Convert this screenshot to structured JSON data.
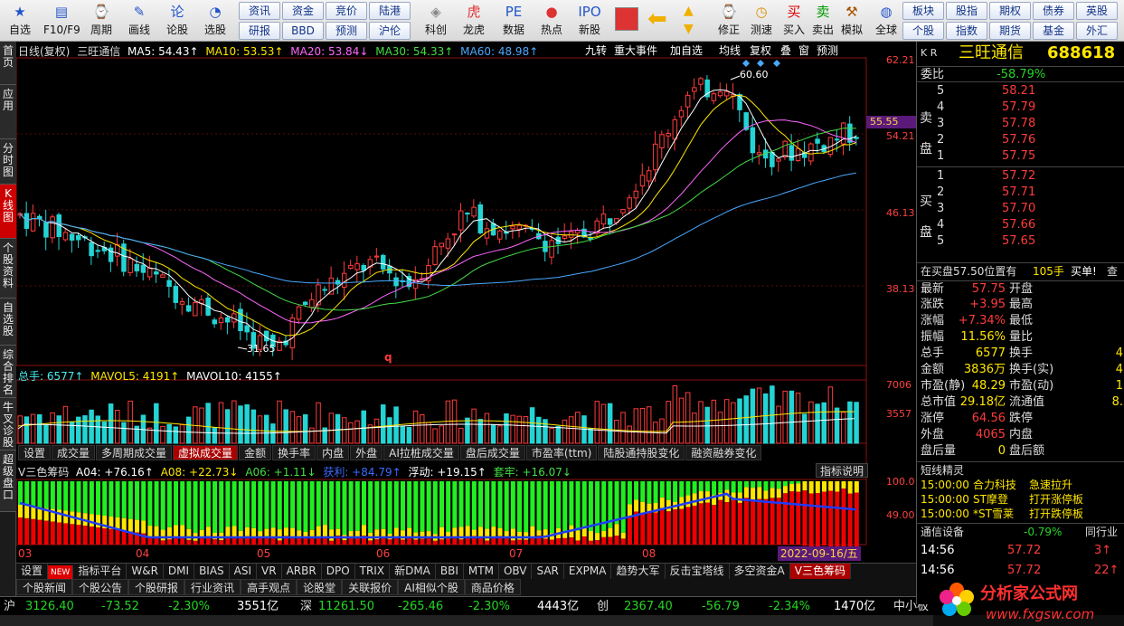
{
  "toolbar": {
    "buttons": [
      {
        "label": "自选",
        "icon": "★"
      },
      {
        "label": "F10/F9",
        "icon": "▤"
      },
      {
        "label": "周期",
        "icon": "⌚"
      },
      {
        "label": "画线",
        "icon": "✎"
      },
      {
        "label": "论股",
        "icon": "论"
      },
      {
        "label": "选股",
        "icon": "◔"
      },
      {
        "label": "科创",
        "icon": "◈"
      },
      {
        "label": "龙虎",
        "icon": "虎"
      },
      {
        "label": "数据",
        "icon": "PE"
      },
      {
        "label": "热点",
        "icon": "●"
      },
      {
        "label": "新股",
        "icon": "IPO"
      },
      {
        "label": "修正",
        "icon": "⌚"
      },
      {
        "label": "测速",
        "icon": "◷"
      },
      {
        "label": "买入",
        "icon": "买"
      },
      {
        "label": "卖出",
        "icon": "卖"
      },
      {
        "label": "模拟",
        "icon": "⚒"
      },
      {
        "label": "全球",
        "icon": "◍"
      }
    ],
    "mini_group1": [
      "资讯",
      "资金",
      "竞价",
      "陆港",
      "研报",
      "BBD",
      "预测",
      "沪伦"
    ],
    "mini_group2": [
      "板块",
      "股指",
      "期权",
      "债券",
      "英股",
      "个股",
      "指数",
      "期货",
      "基金",
      "外汇"
    ]
  },
  "left_tabs": [
    "首页",
    "应用",
    "分时图",
    "K线图",
    "个股资料",
    "自选股",
    "综合排名",
    "牛叉诊股",
    "超级盘口"
  ],
  "chart": {
    "header": {
      "title": "日线(复权)",
      "stock": "三旺通信",
      "ma5": "MA5: 54.43↑",
      "ma10": "MA10: 53.53↑",
      "ma20": "MA20: 53.84↓",
      "ma30": "MA30: 54.33↑",
      "ma60": "MA60: 48.98↑"
    },
    "top_buttons": [
      "九转",
      "重大事件",
      "加自选",
      "均线",
      "复权",
      "叠",
      "窗",
      "预测"
    ],
    "price_axis": [
      "62.21",
      "54.21",
      "46.13",
      "38.13"
    ],
    "current_price_tag": "55.55",
    "high_label": "60.60",
    "low_label": "31.65",
    "mark_q": "q",
    "vol_header": {
      "total": "总手: 6577↑",
      "mavol5": "MAVOL5: 4191↑",
      "mavol10": "MAVOL10: 4155↑"
    },
    "vol_axis": [
      "7006",
      "3557"
    ],
    "sub_tabs": [
      "设置",
      "成交量",
      "多周期成交量",
      "虚拟成交量",
      "金额",
      "换手率",
      "内盘",
      "外盘",
      "AI拉桩成交量",
      "盘后成交量",
      "市盈率(ttm)",
      "陆股通持股变化",
      "融资融券变化"
    ],
    "sub_tabs_active": 3,
    "ind_header": {
      "name": "V三色筹码",
      "a04": "A04: +76.16↑",
      "a08": "A08: +22.73↓",
      "a06": "A06: +1.11↓",
      "gain": "获利: +84.79↑",
      "float": "浮动: +19.15↑",
      "trap": "套牢: +16.07↓"
    },
    "ind_help": "指标说明",
    "ind_axis": [
      "100.0",
      "49.00"
    ],
    "months": [
      "03",
      "04",
      "05",
      "06",
      "07",
      "08"
    ],
    "date_tag": "2022-09-16/五"
  },
  "indicator_tabs": [
    "设置",
    "NEW",
    "指标平台",
    "W&R",
    "DMI",
    "BIAS",
    "ASI",
    "VR",
    "ARBR",
    "DPO",
    "TRIX",
    "新DMA",
    "BBI",
    "MTM",
    "OBV",
    "SAR",
    "EXPMA",
    "趋势大军",
    "反击宝塔线",
    "多空资金A",
    "V三色筹码"
  ],
  "news_tabs": [
    "个股新闻",
    "个股公告",
    "个股研报",
    "行业资讯",
    "高手观点",
    "论股堂",
    "关联报价",
    "AI相似个股",
    "商品价格"
  ],
  "index_bar": {
    "sh_label": "沪",
    "sh_value": "3126.40",
    "sh_change": "-73.52",
    "sh_pct": "-2.30%",
    "sh_amount": "3551亿",
    "sz_label": "深",
    "sz_value": "11261.50",
    "sz_change": "-265.46",
    "sz_pct": "-2.30%",
    "sz_amount": "4443亿",
    "cy_label": "创",
    "cy_value": "2367.40",
    "cy_change": "-56.79",
    "cy_pct": "-2.34%",
    "cy_amount": "1470亿",
    "zx_label": "中小板"
  },
  "quote": {
    "market": "K R",
    "name": "三旺通信",
    "code": "688618",
    "weibi_label": "委比",
    "weibi": "-58.79%",
    "sell_label": "卖盘",
    "buy_label": "买盘",
    "sell": [
      {
        "lvl": "5",
        "price": "58.21"
      },
      {
        "lvl": "4",
        "price": "57.79"
      },
      {
        "lvl": "3",
        "price": "57.78"
      },
      {
        "lvl": "2",
        "price": "57.76"
      },
      {
        "lvl": "1",
        "price": "57.75"
      }
    ],
    "buy": [
      {
        "lvl": "1",
        "price": "57.72"
      },
      {
        "lvl": "2",
        "price": "57.71"
      },
      {
        "lvl": "3",
        "price": "57.70"
      },
      {
        "lvl": "4",
        "price": "57.66"
      },
      {
        "lvl": "5",
        "price": "57.65"
      }
    ],
    "bid_ask_info": "在买盘57.50位置有",
    "bid_ask_qty": "105手",
    "bid_ask_tag": "买单!",
    "bid_ask_more": "查",
    "stats": [
      {
        "l1": "最新",
        "v1": "57.75",
        "c1": "red",
        "l2": "开盘",
        "v2": "",
        "c2": "red"
      },
      {
        "l1": "涨跌",
        "v1": "+3.95",
        "c1": "red",
        "l2": "最高",
        "v2": "",
        "c2": "red"
      },
      {
        "l1": "涨幅",
        "v1": "+7.34%",
        "c1": "red",
        "l2": "最低",
        "v2": "",
        "c2": "red"
      },
      {
        "l1": "振幅",
        "v1": "11.56%",
        "c1": "yel",
        "l2": "量比",
        "v2": "",
        "c2": "yel"
      },
      {
        "l1": "总手",
        "v1": "6577",
        "c1": "yel",
        "l2": "换手",
        "v2": "4",
        "c2": "yel"
      },
      {
        "l1": "金额",
        "v1": "3836万",
        "c1": "yel",
        "l2": "换手(实)",
        "v2": "4",
        "c2": "yel"
      },
      {
        "l1": "市盈(静)",
        "v1": "48.29",
        "c1": "yel",
        "l2": "市盈(动)",
        "v2": "1",
        "c2": "yel"
      },
      {
        "l1": "总市值",
        "v1": "29.18亿",
        "c1": "yel",
        "l2": "流通值",
        "v2": "8.",
        "c2": "yel"
      },
      {
        "l1": "涨停",
        "v1": "64.56",
        "c1": "red",
        "l2": "跌停",
        "v2": "",
        "c2": "grn"
      },
      {
        "l1": "外盘",
        "v1": "4065",
        "c1": "red",
        "l2": "内盘",
        "v2": "",
        "c2": "grn"
      },
      {
        "l1": "盘后量",
        "v1": "0",
        "c1": "yel",
        "l2": "盘后额",
        "v2": "",
        "c2": "yel"
      }
    ],
    "elf_title": "短线精灵",
    "elf": [
      {
        "time": "15:00:00",
        "name": "合力科技",
        "event": "急速拉升"
      },
      {
        "time": "15:00:00",
        "name": "ST摩登",
        "event": "打开涨停板"
      },
      {
        "time": "15:00:00",
        "name": "*ST雪莱",
        "event": "打开跌停板"
      }
    ],
    "industry_name": "通信设备",
    "industry_pct": "-0.79%",
    "industry_tag": "同行业",
    "ticks": [
      {
        "time": "14:56",
        "price": "57.72",
        "qty": "3↑"
      },
      {
        "time": "14:56",
        "price": "57.72",
        "qty": "22↑"
      }
    ]
  },
  "watermark": {
    "title": "分析家公式网",
    "url": "www.fxgsw.com"
  },
  "colors": {
    "up": "#ff3b3b",
    "down": "#24d4d4",
    "ma5": "#ffffff",
    "ma10": "#ffe600",
    "ma20": "#ff66ff",
    "ma30": "#44dd44",
    "ma60": "#4aa8ff"
  }
}
